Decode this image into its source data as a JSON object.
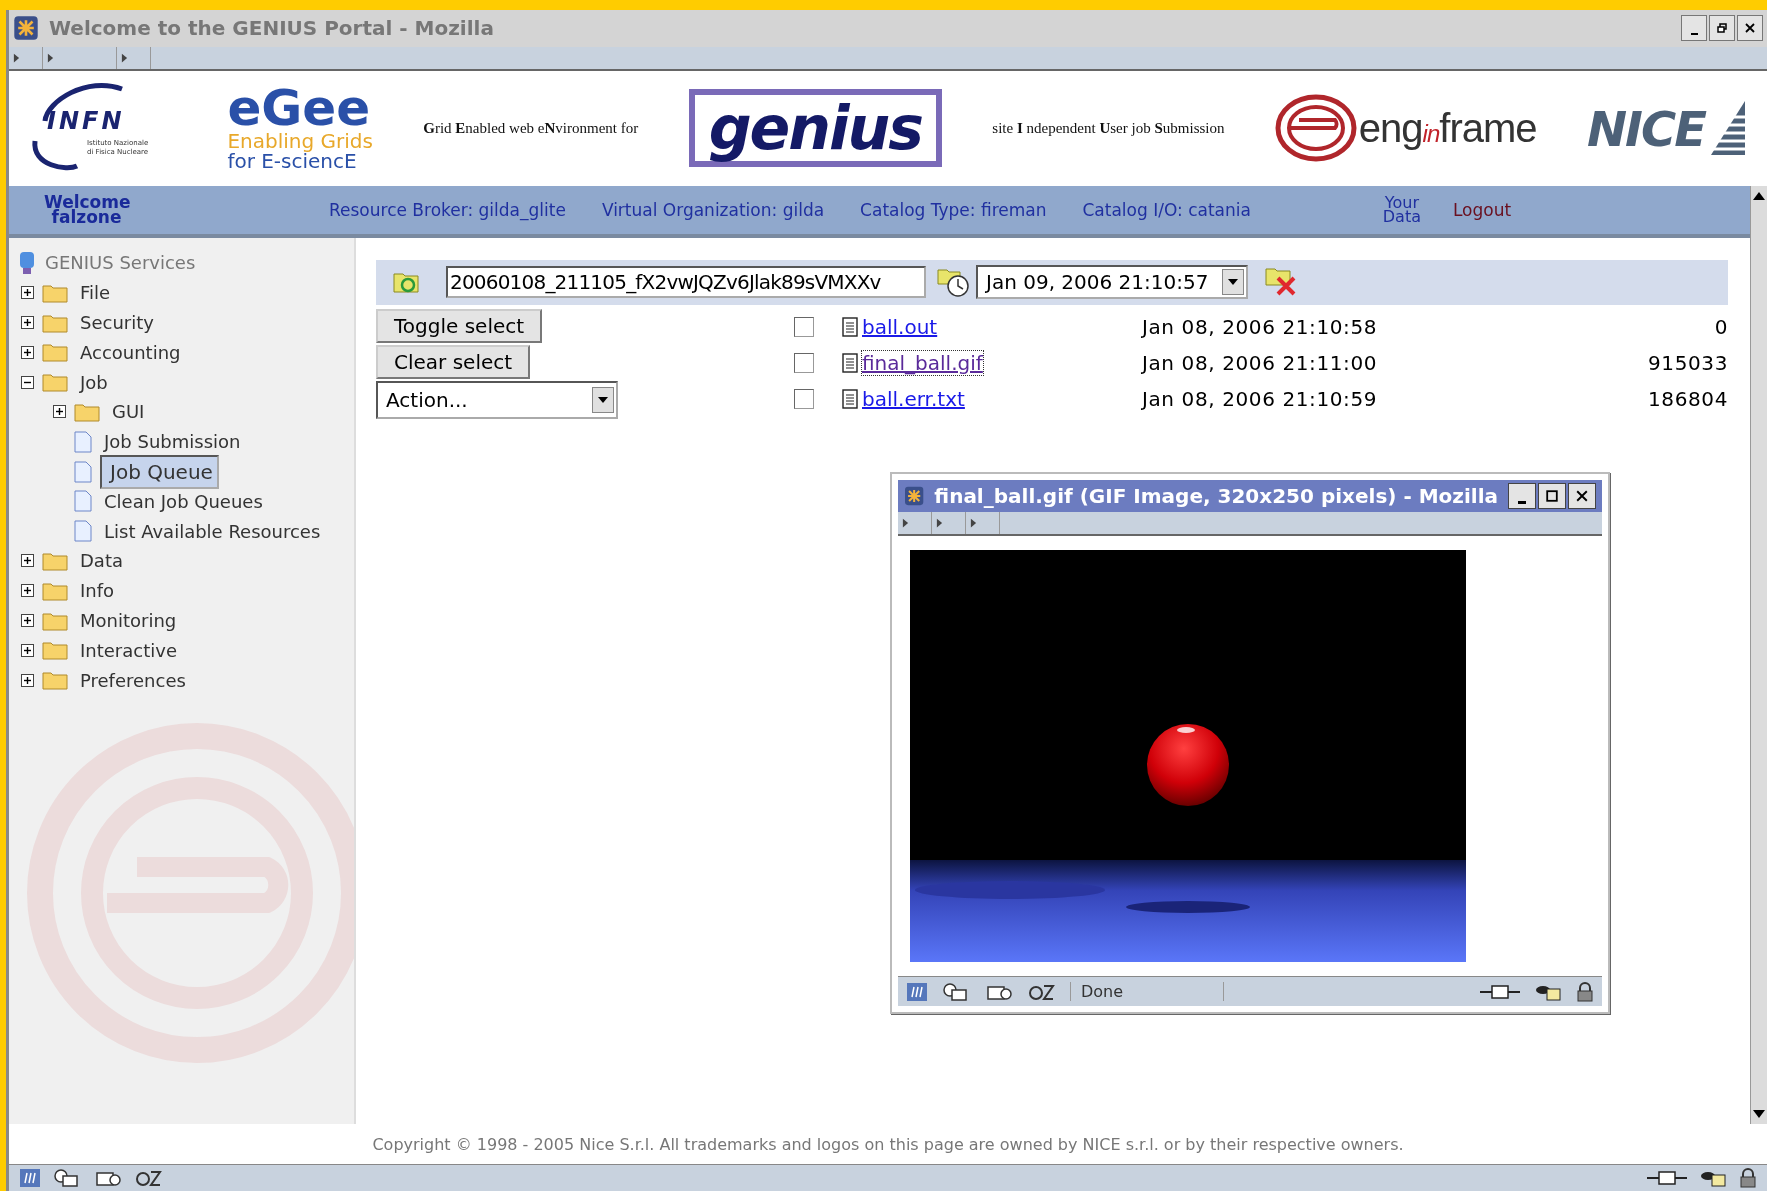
{
  "window": {
    "title": "Welcome to the GENIUS Portal - Mozilla"
  },
  "header": {
    "infn": {
      "name": "INFN",
      "subtitle": [
        "Istituto Nazionale",
        "di Fisica Nucleare"
      ]
    },
    "egee": {
      "name": "eGee",
      "lines": [
        "Enabling Grids",
        "for E-sciencE"
      ]
    },
    "tagline_left": "**G**rid **E**nabled web e**N**vironment for",
    "genius": "genius",
    "tagline_right": "site **I** ndependent **U**ser job **S**ubmission",
    "enginframe": [
      "eng",
      "in",
      "frame"
    ],
    "nice": "NICE"
  },
  "nav": {
    "welcome": "Welcome falzone",
    "items": [
      "Resource Broker: gilda_glite",
      "Virtual Organization: gilda",
      "Catalog Type: fireman",
      "Catalog I/O: catania"
    ],
    "your_data": "Your Data",
    "logout": "Logout"
  },
  "sidebar": {
    "title": "GENIUS Services",
    "tree": [
      {
        "label": "File",
        "kind": "folder",
        "expanded": false,
        "selected": false
      },
      {
        "label": "Security",
        "kind": "folder",
        "expanded": false,
        "selected": false
      },
      {
        "label": "Accounting",
        "kind": "folder",
        "expanded": false,
        "selected": false
      },
      {
        "label": "Job",
        "kind": "folder",
        "expanded": true,
        "selected": false,
        "children": [
          {
            "label": "GUI",
            "kind": "folder",
            "expanded": false,
            "selected": false
          },
          {
            "label": "Job Submission",
            "kind": "page",
            "selected": false
          },
          {
            "label": "Job Queue",
            "kind": "page",
            "selected": true
          },
          {
            "label": "Clean Job Queues",
            "kind": "page",
            "selected": false
          },
          {
            "label": "List Available Resources",
            "kind": "page",
            "selected": false
          }
        ]
      },
      {
        "label": "Data",
        "kind": "folder",
        "expanded": false,
        "selected": false
      },
      {
        "label": "Info",
        "kind": "folder",
        "expanded": false,
        "selected": false
      },
      {
        "label": "Monitoring",
        "kind": "folder",
        "expanded": false,
        "selected": false
      },
      {
        "label": "Interactive",
        "kind": "folder",
        "expanded": false,
        "selected": false
      },
      {
        "label": "Preferences",
        "kind": "folder",
        "expanded": false,
        "selected": false
      }
    ]
  },
  "job": {
    "job_id": "20060108_211105_fX2vwJQZv6Jlak89sVMXXv",
    "date": "Jan 09, 2006 21:10:57"
  },
  "controls": {
    "toggle": "Toggle select",
    "clear": "Clear select",
    "action": "Action..."
  },
  "files": [
    {
      "name": "ball.out",
      "date": "Jan 08, 2006 21:10:58",
      "size": "0",
      "checked": false,
      "visited": false
    },
    {
      "name": "final_ball.gif",
      "date": "Jan 08, 2006 21:11:00",
      "size": "915033",
      "checked": false,
      "visited": true
    },
    {
      "name": "ball.err.txt",
      "date": "Jan 08, 2006 21:10:59",
      "size": "186804",
      "checked": false,
      "visited": false
    }
  ],
  "popup": {
    "title": "final_ball.gif (GIF Image, 320x250 pixels) - Mozilla",
    "status": "Done"
  },
  "footer": "Copyright © 1998 - 2005 Nice S.r.l. All trademarks and logos on this page are owned by NICE s.r.l. or by their respective owners."
}
